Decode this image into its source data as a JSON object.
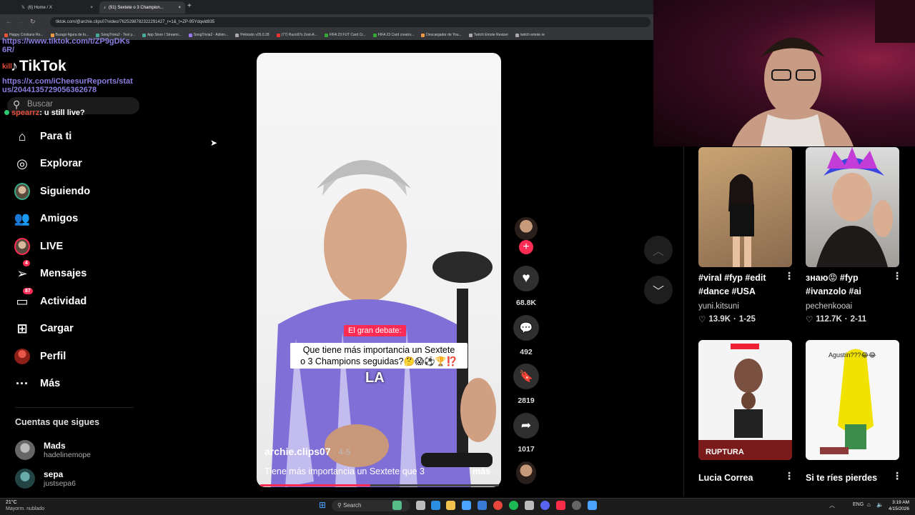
{
  "browser": {
    "tabs": [
      {
        "label": "(6) Home / X"
      },
      {
        "label": "(91) Sextete o 3 Champion..."
      }
    ],
    "url": "tiktok.com/@archie.clips07/video/7625298782322291427_r=1&_t=ZP-95Ydqeld835",
    "bookmarks": [
      "Happy Cristiano Ro...",
      "Burago figura de to...",
      "SongTrivia2 - Test y...",
      "App Store / Streami...",
      "SongTrivia2 - Adivin...",
      "Pelotodo v26.0.28",
      "(77) Razo97s Zest-A...",
      "FIFA 23 FUT Card Cr...",
      "FIFA 23 Card creator...",
      "Descargador de You...",
      "Twitch Emote Resizer",
      "twitch emote re"
    ]
  },
  "chat": {
    "line1": "https://www.tiktok.com/t/ZP9gDKs",
    "line2": "6R/",
    "line3_user": "kill",
    "line4": "https://x.com/iCheesurReports/stat",
    "line5": "us/2044135729056362678",
    "line6_user": "spearrz",
    "line6_msg": ": u still live?"
  },
  "tiktok": {
    "logo_text": "TikTok",
    "search_placeholder": "Buscar",
    "nav": [
      {
        "label": "Para ti",
        "icon": "home-icon"
      },
      {
        "label": "Explorar",
        "icon": "compass-icon"
      },
      {
        "label": "Siguiendo",
        "icon": "following-avatar-icon"
      },
      {
        "label": "Amigos",
        "icon": "friends-icon"
      },
      {
        "label": "LIVE",
        "icon": "live-avatar-icon"
      },
      {
        "label": "Mensajes",
        "icon": "messages-icon",
        "badge": "4"
      },
      {
        "label": "Actividad",
        "icon": "activity-icon",
        "badge": "87"
      },
      {
        "label": "Cargar",
        "icon": "upload-icon"
      },
      {
        "label": "Perfil",
        "icon": "profile-icon"
      },
      {
        "label": "Más",
        "icon": "more-icon"
      }
    ],
    "following_heading": "Cuentas que sigues",
    "following": [
      {
        "name": "Mads",
        "handle": "hadelinemope"
      },
      {
        "name": "sepa",
        "handle": "justsepa6"
      }
    ]
  },
  "video": {
    "caption_tag": "El gran debate:",
    "caption_line1": "Que tiene más importancia un Sextete",
    "caption_line2": "o 3 Champions seguidas?🤔😱⚽🏆⁉️",
    "subtitle_word": "LA",
    "author": "archie.clips07",
    "date": " · 4-5",
    "description": "Tiene más importancia un Sextete que 3",
    "more": "más",
    "progress": 0.46
  },
  "actions": {
    "likes": "68.8K",
    "comments": "492",
    "saves": "2819",
    "shares": "1017"
  },
  "grid": [
    {
      "title": "#viral #fyp #edit #dance #USA",
      "user": "yuni.kitsuni",
      "views": "13.9K",
      "date": "1-25"
    },
    {
      "title": "знаю😡 #fyp #ivanzolo #ai",
      "user": "pechenkooai",
      "views": "112.7K",
      "date": "2-11"
    },
    {
      "title": "Lucia Correa",
      "overlay": "RUPTURA"
    },
    {
      "title": "Si te ríes pierdes",
      "overlay": "Agustín???😂😂"
    }
  ],
  "taskbar": {
    "weather_temp": "21°C",
    "weather_desc": "Mayorm. nublado",
    "search_label": "Search",
    "lang": "ENG",
    "time": "3:19 AM",
    "date": "4/15/2026"
  },
  "colors": {
    "accent": "#fe2c55",
    "link": "#8a7fe0",
    "online": "#2ecc71"
  }
}
